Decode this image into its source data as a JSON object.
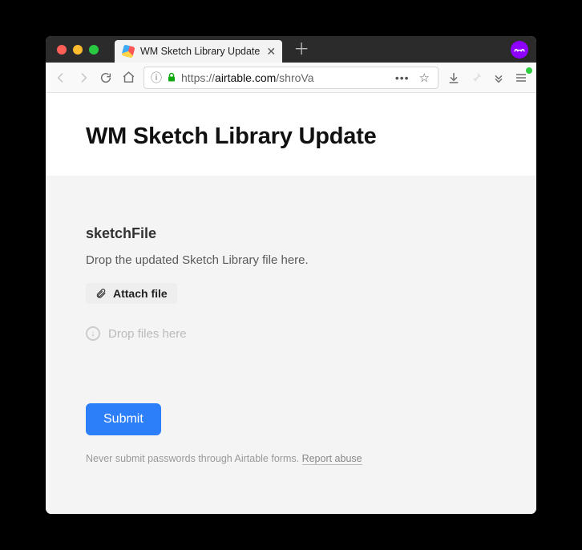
{
  "browser": {
    "tab_title": "WM Sketch Library Update",
    "url_proto": "https://",
    "url_host": "airtable.com",
    "url_path": "/shroVa"
  },
  "form": {
    "title": "WM Sketch Library Update",
    "field_label": "sketchFile",
    "field_desc": "Drop the updated Sketch Library file here.",
    "attach_label": "Attach file",
    "dropzone_text": "Drop files here",
    "submit_label": "Submit",
    "disclaimer_text": "Never submit passwords through Airtable forms. ",
    "report_abuse_label": "Report abuse"
  }
}
